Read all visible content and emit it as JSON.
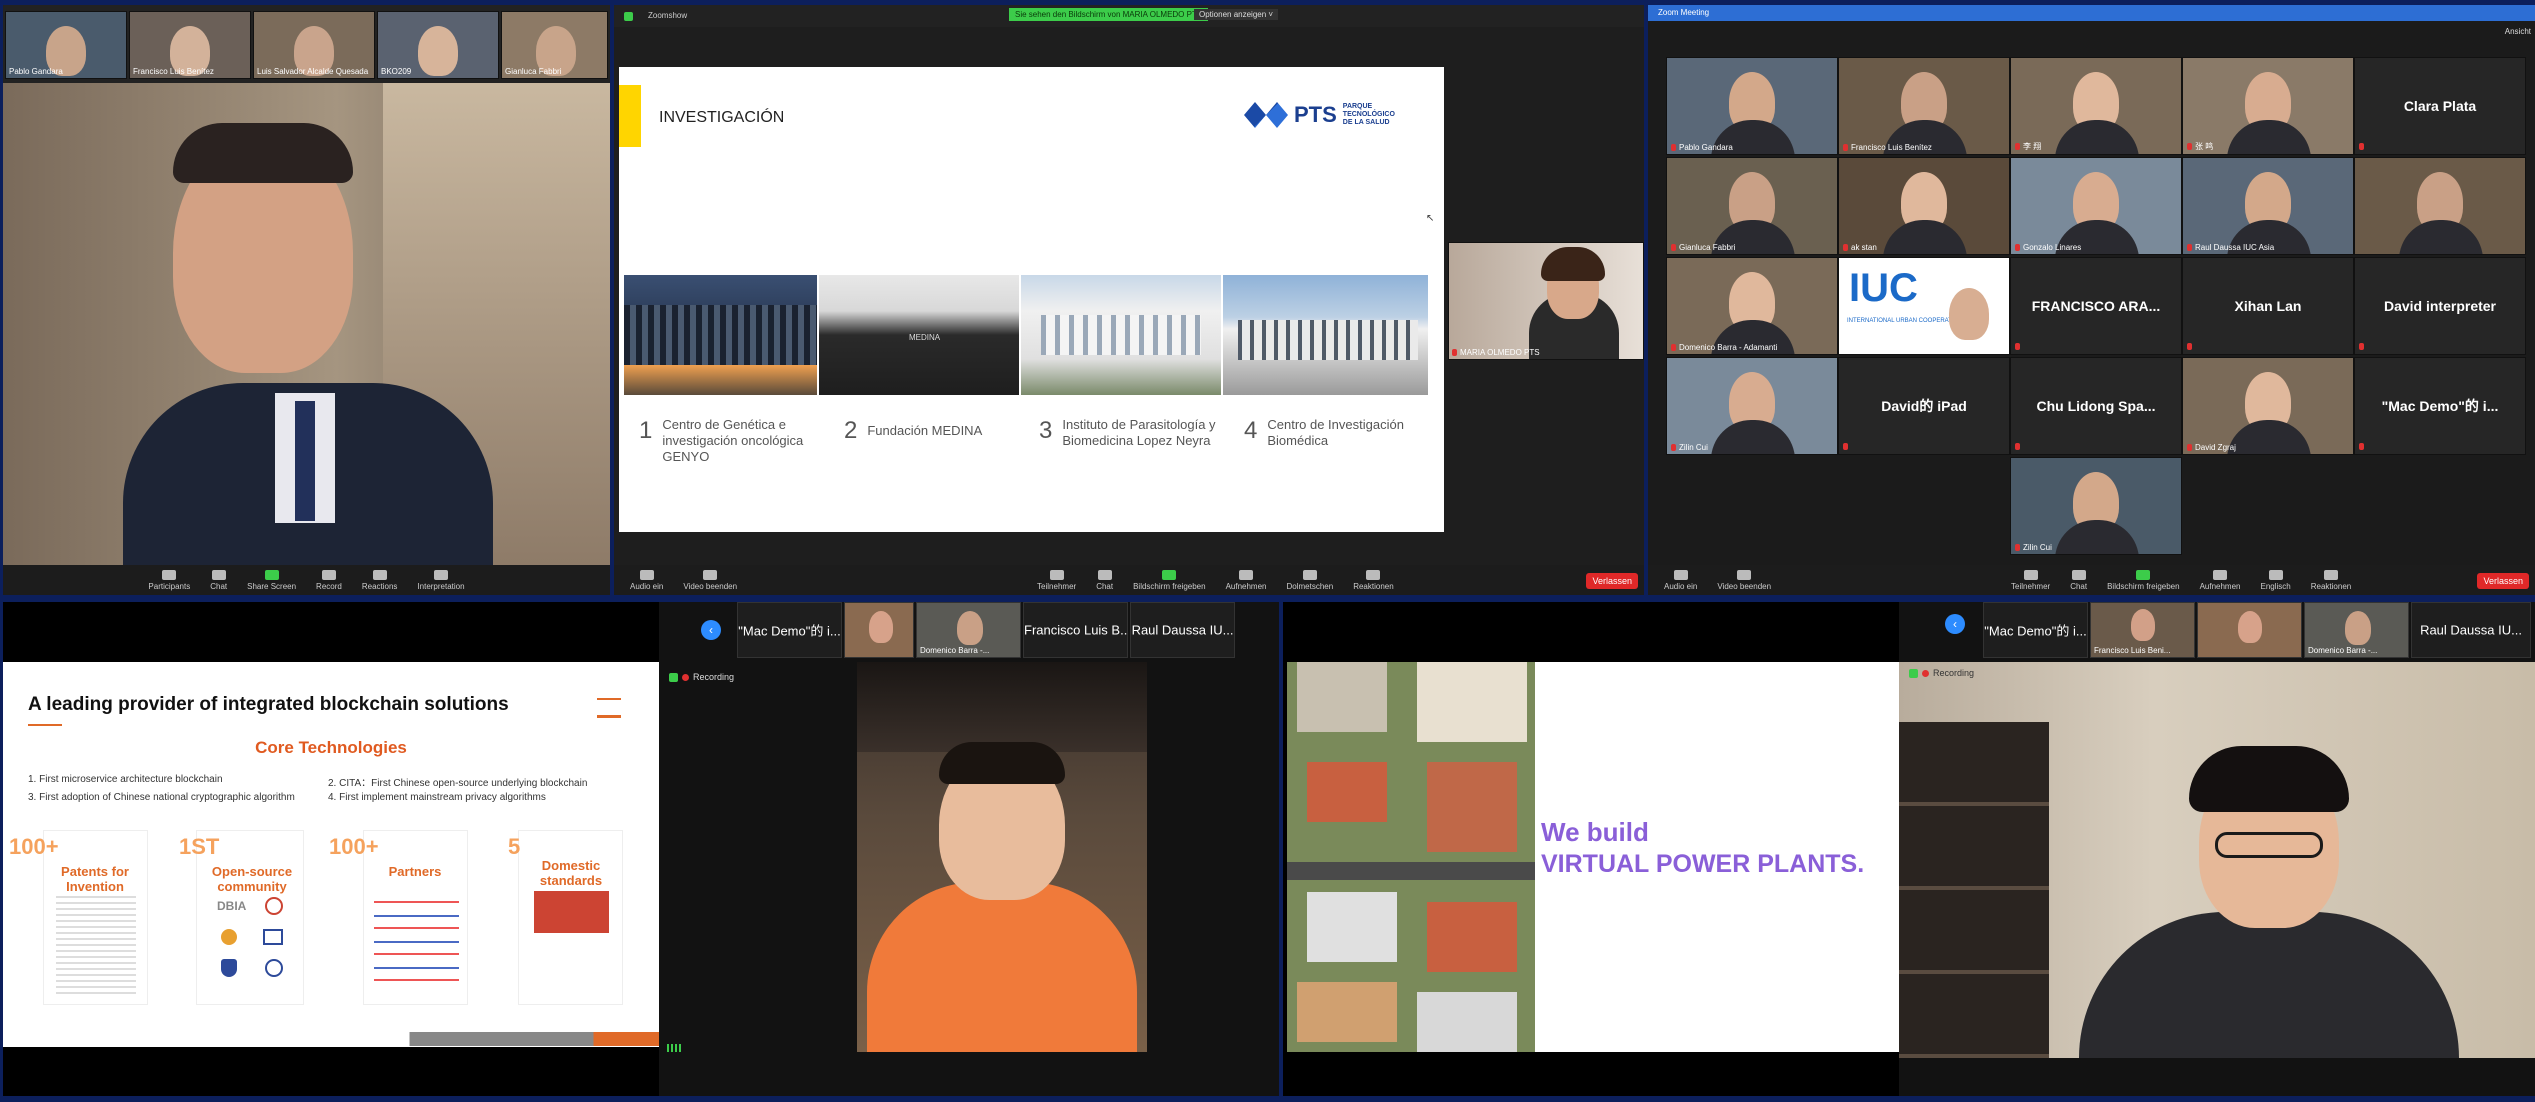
{
  "panel1": {
    "thumbs": [
      "Pablo Gandara",
      "Francisco Luis Benítez",
      "Luis Salvador Alcalde Quesada",
      "BKO209",
      "Gianluca Fabbri"
    ],
    "toolbar": [
      "Participants",
      "Chat",
      "Share Screen",
      "Record",
      "Reactions",
      "Interpretation"
    ]
  },
  "panel2": {
    "app_label": "Zoomshow",
    "share_banner": "Sie sehen den Bildschirm von MARIA OLMEDO PTS",
    "view_options": "Optionen anzeigen ˅",
    "slide_title": "INVESTIGACIÓN",
    "logo_main": "PTS",
    "logo_sub1": "PARQUE",
    "logo_sub2": "TECNOLÓGICO",
    "logo_sub3": "DE LA SALUD",
    "items": [
      {
        "num": "1",
        "text": "Centro de Genética e investigación oncológica GENYO"
      },
      {
        "num": "2",
        "text": "Fundación MEDINA"
      },
      {
        "num": "3",
        "text": "Instituto de Parasitología y Biomedicina Lopez Neyra"
      },
      {
        "num": "4",
        "text": "Centro de Investigación Biomédica"
      }
    ],
    "building_sign": "MEDINA",
    "speaker_name": "MARIA OLMEDO PTS",
    "toolbar_left": [
      "Audio ein",
      "Video beenden"
    ],
    "toolbar_center": [
      "Teilnehmer",
      "Chat",
      "Bildschirm freigeben",
      "Aufnehmen",
      "Dolmetschen",
      "Reaktionen"
    ],
    "end_label": "Verlassen"
  },
  "panel3": {
    "title": "Zoom Meeting",
    "view_label": "Ansicht",
    "tiles": [
      {
        "name": "Pablo Gandara",
        "type": "video"
      },
      {
        "name": "Francisco Luis Benítez",
        "type": "video"
      },
      {
        "name": "李 翔",
        "type": "video"
      },
      {
        "name": "张 鸣",
        "type": "video"
      },
      {
        "name": "Clara Plata",
        "type": "text"
      },
      {
        "name": "Gianluca Fabbri",
        "type": "video"
      },
      {
        "name": "ak stan",
        "type": "video"
      },
      {
        "name": "Gonzalo Linares",
        "type": "video"
      },
      {
        "name": "Raul Daussa IUC Asia",
        "type": "video"
      },
      {
        "name": "",
        "type": "video"
      },
      {
        "name": "Domenico Barra - Adamanti",
        "type": "video"
      },
      {
        "name": "",
        "type": "iuc"
      },
      {
        "name": "FRANCISCO  ARA...",
        "type": "text"
      },
      {
        "name": "Xihan Lan",
        "type": "text"
      },
      {
        "name": "David interpreter",
        "type": "text"
      },
      {
        "name": "Zilin Cui",
        "type": "video"
      },
      {
        "name": "David的 iPad",
        "type": "text"
      },
      {
        "name": "Chu Lidong Spa...",
        "type": "text"
      },
      {
        "name": "David Zgraj",
        "type": "video"
      },
      {
        "name": "\"Mac Demo\"的 i...",
        "type": "text"
      },
      {
        "name": "Zilin Cui",
        "type": "video"
      }
    ],
    "iuc_logo": "IUC",
    "iuc_caption": "INTERNATIONAL URBAN COOPERATION",
    "toolbar_left": [
      "Audio ein",
      "Video beenden"
    ],
    "toolbar_center": [
      "Teilnehmer",
      "Chat",
      "Bildschirm freigeben",
      "Aufnehmen",
      "Englisch",
      "Reaktionen"
    ],
    "end_label": "Verlassen"
  },
  "panel4": {
    "slide_title": "A leading provider of integrated blockchain solutions",
    "subtitle": "Core Technologies",
    "points": [
      "1. First microservice architecture blockchain",
      "2. CITA：First Chinese open-source underlying blockchain",
      "3. First adoption of Chinese national cryptographic algorithm",
      "4. First implement mainstream privacy algorithms"
    ],
    "stats": [
      {
        "num": "100+",
        "label": "Patents for Invention"
      },
      {
        "num": "1ST",
        "label": "Open-source community"
      },
      {
        "num": "100+",
        "label": "Partners"
      },
      {
        "num": "5",
        "label": "Domestic standards"
      }
    ],
    "logo_dbia": "DBIA"
  },
  "panel5": {
    "strip": [
      "\"Mac Demo\"的 i...",
      "",
      "Domenico Barra -...",
      "Francisco Luis B...",
      "Raul Daussa IU..."
    ],
    "recording": "Recording"
  },
  "panel6": {
    "line1": "We build",
    "line2": "VIRTUAL POWER PLANTS."
  },
  "panel7": {
    "strip": [
      "\"Mac Demo\"的 i...",
      "Francisco Luis Beni...",
      "",
      "Domenico Barra -...",
      "Raul Daussa IU..."
    ],
    "recording": "Recording"
  }
}
